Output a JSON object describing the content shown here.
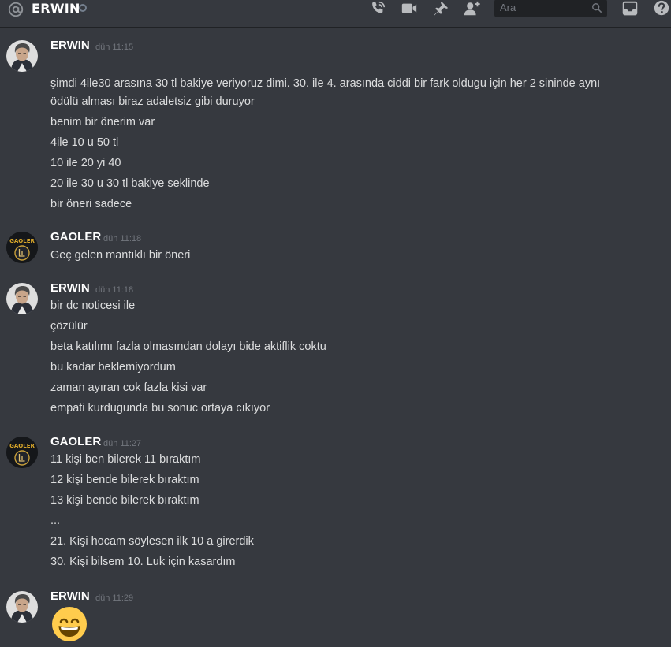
{
  "header": {
    "channel_name": "ERWIN",
    "search_placeholder": "Ara",
    "icons": [
      "at-icon",
      "call-icon",
      "video-icon",
      "pin-icon",
      "add-friend-icon",
      "search-icon",
      "inbox-icon",
      "help-icon"
    ]
  },
  "colors": {
    "background": "#36393f",
    "header_divider": "#202225",
    "author": "#ffffff",
    "text": "#dcddde",
    "timestamp": "#72767d"
  },
  "messages": [
    {
      "author": "ERWIN",
      "timestamp": "dün 11:15",
      "lines": [
        "şimdi 4ile30 arasına 30 tl bakiye veriyoruz dimi. 30. ile 4. arasında ciddi bir fark oldugu için her 2 sininde aynı",
        "ödülü alması biraz adaletsiz gibi duruyor",
        "benim bir önerim var",
        "4ile 10 u 50 tl",
        "10 ile 20 yi 40",
        "20 ile 30 u 30 tl bakiye seklinde",
        "bir öneri sadece"
      ]
    },
    {
      "author": "GAOLER",
      "timestamp": "dün 11:18",
      "lines": [
        "Geç gelen mantıklı bir öneri"
      ]
    },
    {
      "author": "ERWIN",
      "timestamp": "dün 11:18",
      "lines": [
        "bir dc noticesi ile",
        "çözülür",
        "beta katılımı fazla olmasından dolayı bide aktiflik coktu",
        "bu kadar beklemiyordum",
        "zaman ayıran cok fazla kisi var",
        "empati kurdugunda bu sonuc ortaya cıkıyor"
      ]
    },
    {
      "author": "GAOLER",
      "timestamp": "dün 11:27",
      "lines": [
        "11 kişi ben bilerek 11 bıraktım",
        "12 kişi bende bilerek bıraktım",
        "13 kişi bende bilerek bıraktım",
        "...",
        "21. Kişi hocam söylesen ilk 10 a girerdik",
        "30. Kişi bilsem 10. Luk için kasardım"
      ]
    },
    {
      "author": "ERWIN",
      "timestamp": "dün 11:29",
      "emoji": "grinning-face-with-smiling-eyes-emoji"
    }
  ],
  "avatars": {
    "gaoler_logo_text": "GAOLER"
  }
}
